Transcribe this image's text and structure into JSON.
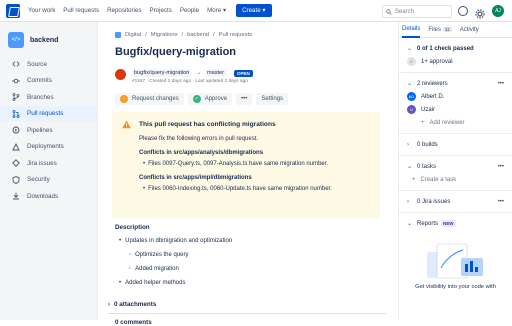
{
  "topbar": {
    "nav": [
      "Your work",
      "Pull requests",
      "Repositories",
      "Projects",
      "People",
      "More"
    ],
    "create": "Create",
    "search_placeholder": "Search",
    "user_initials": "AJ"
  },
  "sidebar": {
    "repo_name": "backend",
    "items": [
      {
        "label": "Source",
        "icon": "code-icon"
      },
      {
        "label": "Commits",
        "icon": "commit-icon"
      },
      {
        "label": "Branches",
        "icon": "branch-icon"
      },
      {
        "label": "Pull requests",
        "icon": "pull-request-icon",
        "active": true
      },
      {
        "label": "Pipelines",
        "icon": "pipeline-icon"
      },
      {
        "label": "Deployments",
        "icon": "deploy-icon"
      },
      {
        "label": "Jira issues",
        "icon": "jira-icon"
      },
      {
        "label": "Security",
        "icon": "shield-icon"
      },
      {
        "label": "Downloads",
        "icon": "download-icon"
      }
    ]
  },
  "breadcrumb": [
    "Digital",
    "Migrations",
    "backend",
    "Pull requests"
  ],
  "pr": {
    "title": "Bugfix/query-migration",
    "source_branch": "bugfix/query-migration",
    "target_branch": "master",
    "status": "OPEN",
    "sub_meta": "#1167 · Created 2 days ago · Last updated 2 days ago",
    "actions": {
      "request_changes": "Request changes",
      "approve": "Approve",
      "settings": "Settings"
    }
  },
  "warning": {
    "title": "This pull request has conflicting migrations",
    "message": "Please fix the following errors in pull request.",
    "conflicts": [
      {
        "title": "Conflicts in src/apps/analysis/dbmigrations",
        "detail": "Files 0097-Query.ts, 0097-Analysis.ts have same migration number."
      },
      {
        "title": "Conflicts in src/apps/impl/dbmigrations",
        "detail": "Files 0060-Indexing.ts, 0060-Update.ts have same migration number."
      }
    ]
  },
  "description": {
    "title": "Description",
    "items": [
      "Updates in dbmigration and optimization",
      "Optimizes the query",
      "Added migration",
      "Added helper methods"
    ]
  },
  "attachments": "0 attachments",
  "comments": "0 comments",
  "right_panel": {
    "tabs": [
      {
        "label": "Details",
        "active": true
      },
      {
        "label": "Files",
        "count": "11"
      },
      {
        "label": "Activity"
      }
    ],
    "checks": "0 of 1 check passed",
    "approval": "1+ approval",
    "reviewers_label": "2 reviewers",
    "reviewers": [
      {
        "name": "Albert D.",
        "initials": "AD",
        "color": "#0065ff"
      },
      {
        "name": "Uzair",
        "initials": "U",
        "color": "#6554c0"
      }
    ],
    "add_reviewer": "Add reviewer",
    "builds": "0 builds",
    "tasks": "0 tasks",
    "create_task": "Create a task",
    "jira_issues": "0 Jira issues",
    "reports": "Reports",
    "reports_badge": "NEW",
    "promo_text": "Get visibility into your code with"
  },
  "colors": {
    "brand": "#0052cc",
    "warning_bg": "#fffae6",
    "warning_icon": "#ff8b00",
    "approve": "#36b37e"
  }
}
